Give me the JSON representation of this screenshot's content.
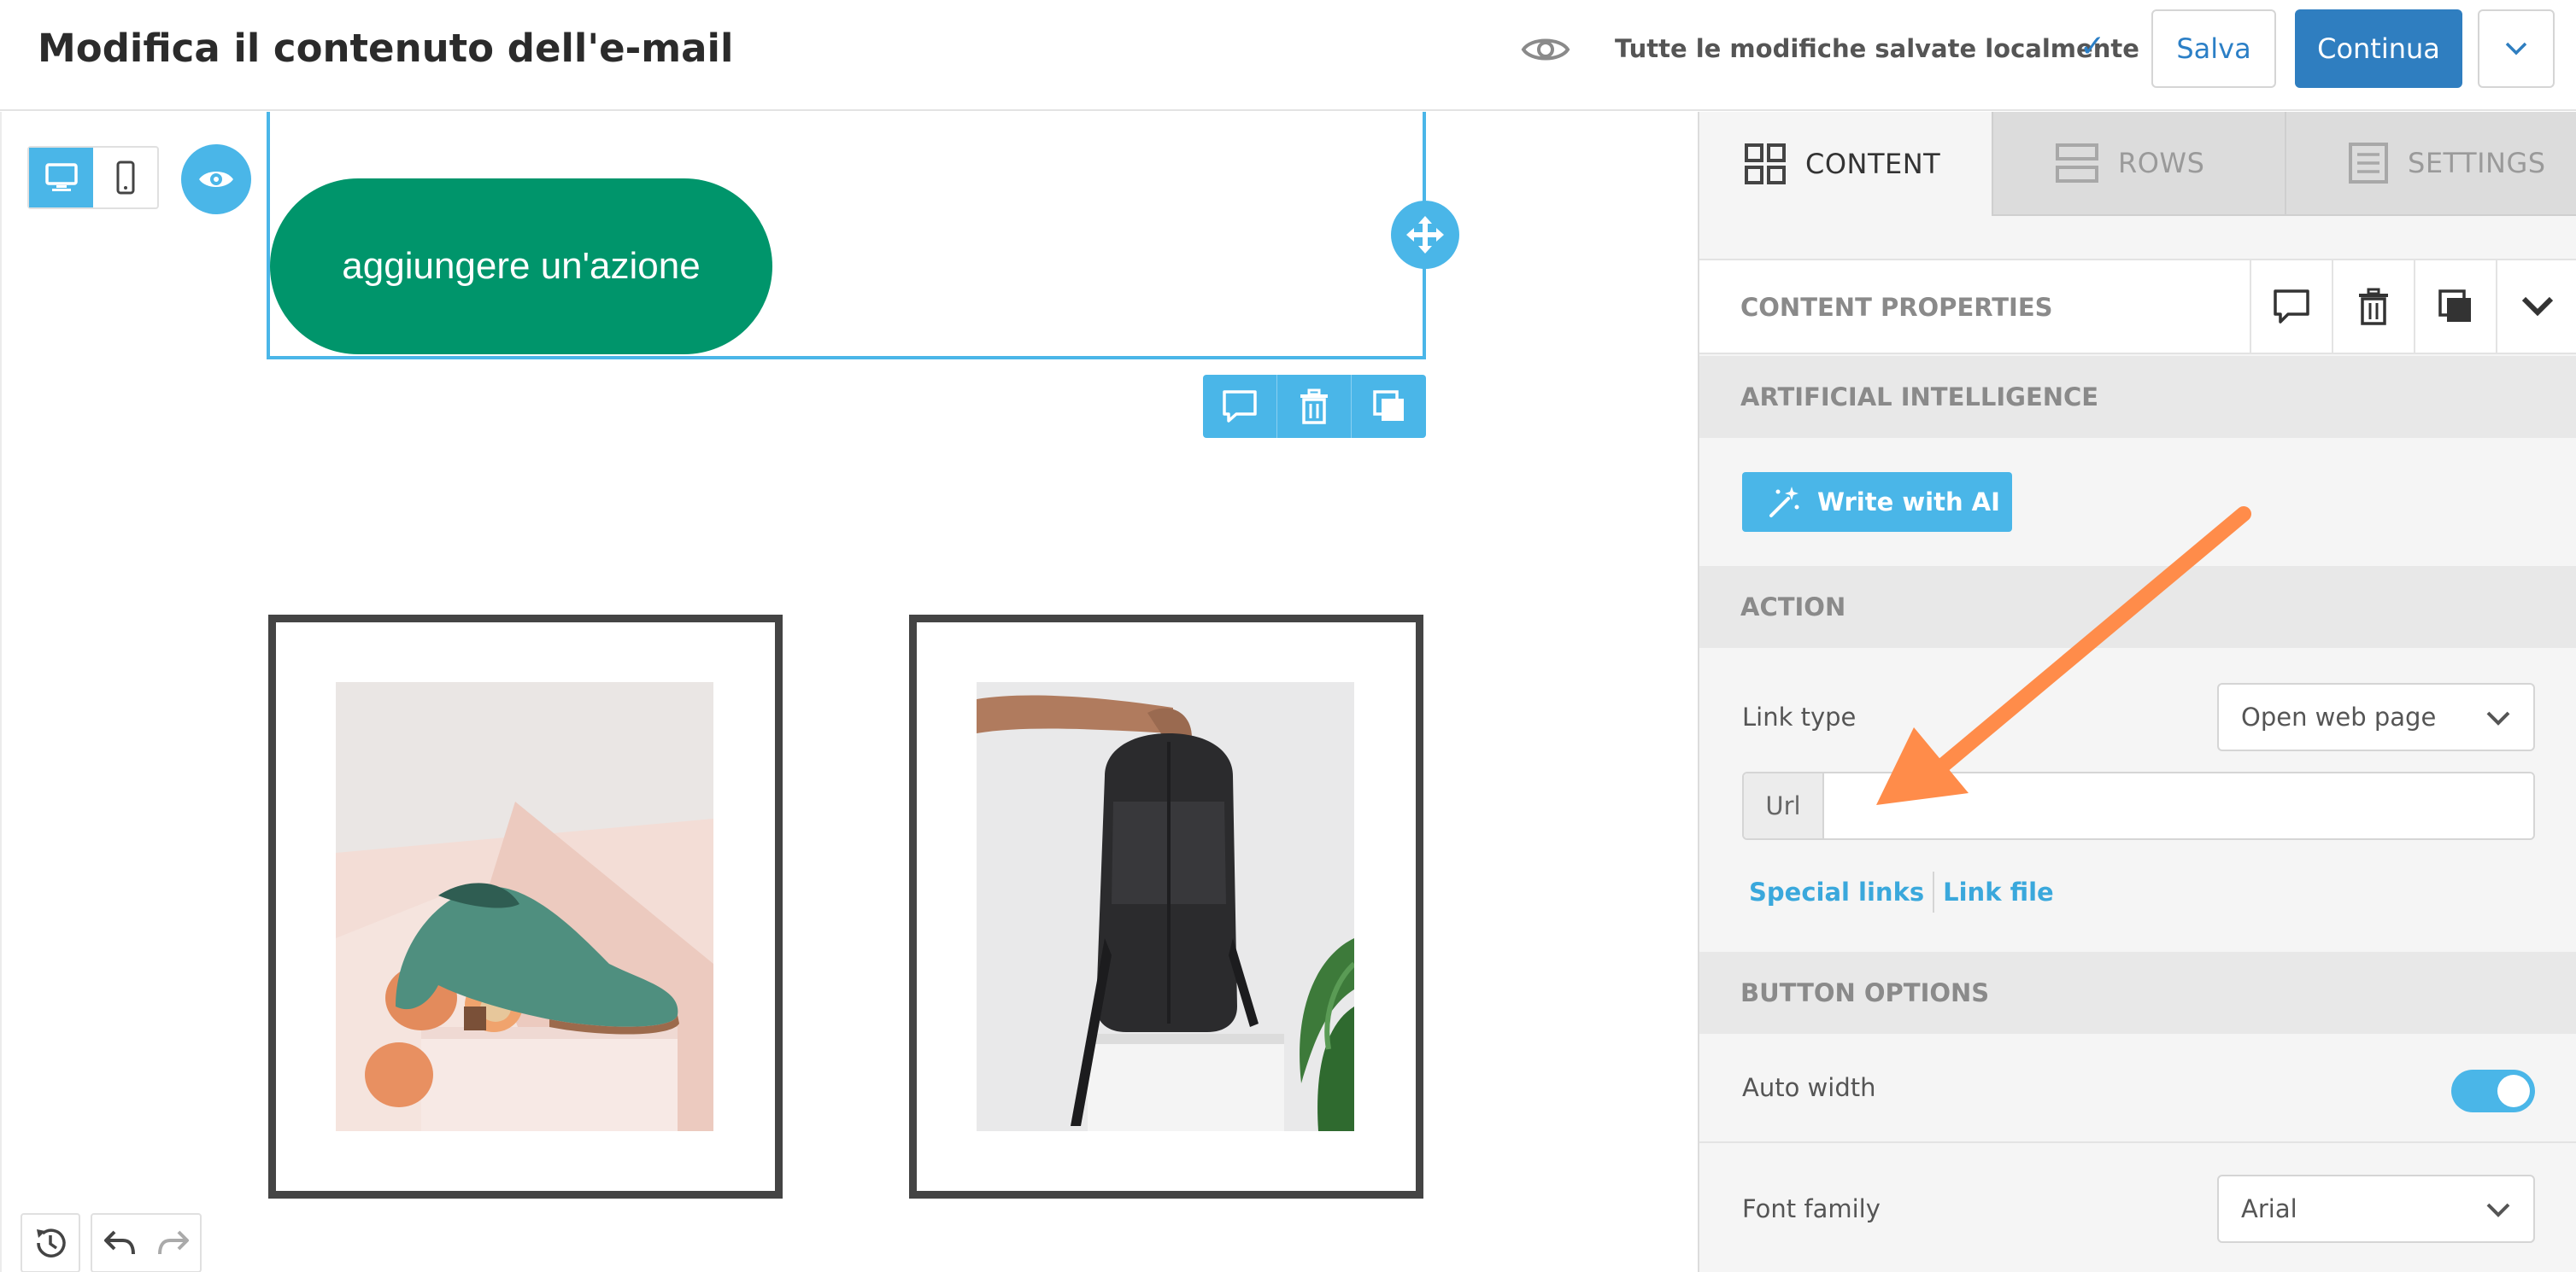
{
  "header": {
    "title": "Modifica il contenuto dell'e-mail",
    "save_status": "Tutte le modifiche salvate localmente",
    "save_check": "✓",
    "save_label": "Salva",
    "continue_label": "Continua",
    "icons": [
      "eye-icon",
      "checkmark-icon",
      "chevron-down-icon"
    ]
  },
  "canvas": {
    "action_button_text": "aggiungere un'azione",
    "button_color": "#00956b",
    "selection_color": "#4ab6e8",
    "products": [
      {
        "name": "product-image-shoe",
        "subject": "green suede brogue shoe with peaches"
      },
      {
        "name": "product-image-backpack",
        "subject": "hand holding black backpack"
      }
    ]
  },
  "panel": {
    "tabs": [
      {
        "label": "CONTENT",
        "icon": "grid-icon",
        "active": true
      },
      {
        "label": "ROWS",
        "icon": "rows-icon",
        "active": false
      },
      {
        "label": "SETTINGS",
        "icon": "settings-list-icon",
        "active": false
      }
    ],
    "content_properties_title": "CONTENT PROPERTIES",
    "sections": {
      "ai": "ARTIFICIAL INTELLIGENCE",
      "action": "ACTION",
      "button_options": "BUTTON OPTIONS"
    },
    "write_ai_label": "Write with AI",
    "link_type_label": "Link type",
    "link_type_value": "Open web page",
    "url_label": "Url",
    "url_value": "",
    "special_links": "Special links",
    "link_file": "Link file",
    "auto_width_label": "Auto width",
    "auto_width_on": true,
    "font_family_label": "Font family",
    "font_family_value": "Arial"
  },
  "annotation": {
    "color": "#ff8c4a"
  }
}
